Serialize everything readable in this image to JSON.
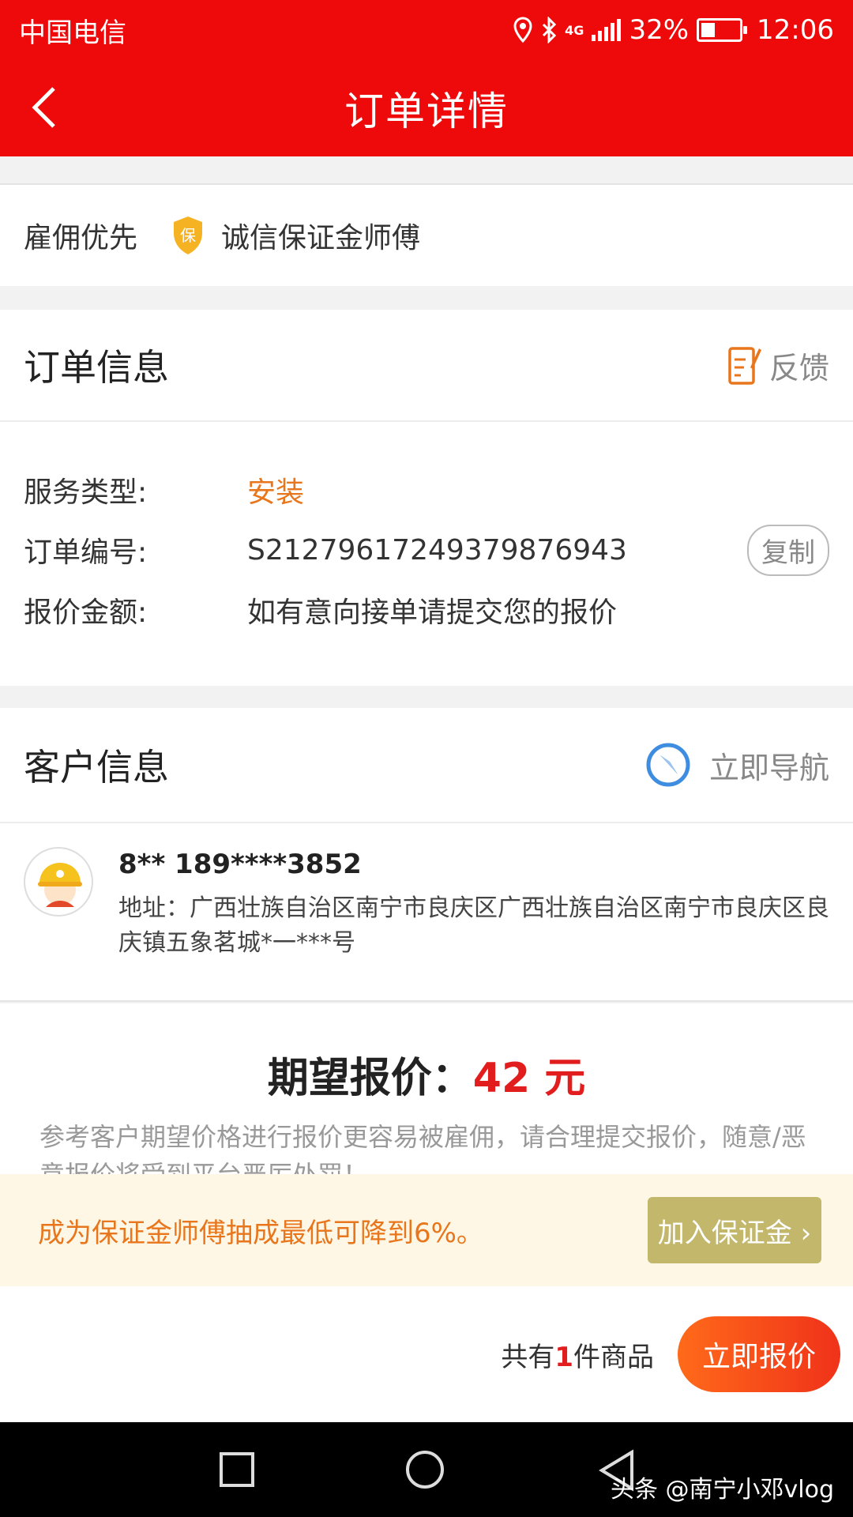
{
  "status_bar": {
    "carrier": "中国电信",
    "network": "4G",
    "battery": "32%",
    "battery_level": 0.32,
    "time": "12:06"
  },
  "nav": {
    "title": "订单详情",
    "back_icon": "chevron-left-icon"
  },
  "priority": {
    "label": "雇佣优先",
    "badge_char": "保",
    "text": "诚信保证金师傅"
  },
  "order_info": {
    "title": "订单信息",
    "feedback_label": "反馈",
    "rows": [
      {
        "key": "服务类型:",
        "value": "安装"
      },
      {
        "key": "订单编号:",
        "value": "S21279617249379876943"
      },
      {
        "key": "报价金额:",
        "value": "如有意向接单请提交您的报价"
      }
    ],
    "copy_label": "复制"
  },
  "customer": {
    "title": "客户信息",
    "navigate_label": "立即导航",
    "name_phone": "8**  189****3852",
    "address": "地址：广西壮族自治区南宁市良庆区广西壮族自治区南宁市良庆区良庆镇五象茗城*一***号"
  },
  "expect": {
    "label": "期望报价：",
    "price": "42 元",
    "hint": "参考客户期望价格进行报价更容易被雇佣，请合理提交报价，随意/恶意报价将受到平台严厉处罚！"
  },
  "promo": {
    "text": "成为保证金师傅抽成最低可降到6%。",
    "button": "加入保证金 ›"
  },
  "footer": {
    "count_prefix": "共有",
    "count_num": "1",
    "count_suffix": "件商品",
    "quote_button": "立即报价"
  },
  "watermark": "头条 @南宁小邓vlog",
  "colors": {
    "brand_red": "#ee0a0a",
    "accent_orange": "#e8761c",
    "price_red": "#e21d1d",
    "promo_button": "#c2b76b"
  }
}
